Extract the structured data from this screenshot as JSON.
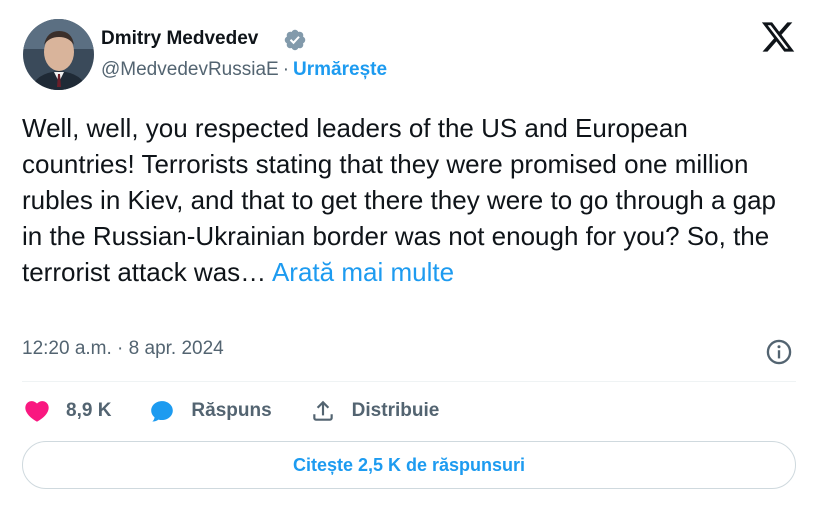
{
  "author": {
    "name": "Dmitry Medvedev",
    "handle": "@MedvedevRussiaE",
    "separator": "·",
    "follow_label": "Urmărește",
    "verified": true
  },
  "brand": {
    "logo_icon": "x-logo-icon"
  },
  "tweet": {
    "text": "Well, well, you respected leaders of the US and European countries! Terrorists stating that they were promised one million rubles in Kiev, and that to get there they were to go through a gap in the Russian-Ukrainian border was not enough for you? So, the terrorist attack was… ",
    "show_more_label": "Arată mai multe"
  },
  "meta": {
    "timestamp": "12:20 a.m. · 8 apr. 2024",
    "info_icon": "info-icon"
  },
  "actions": {
    "likes_count": "8,9 K",
    "reply_label": "Răspuns",
    "share_label": "Distribuie"
  },
  "replies_button": {
    "label": "Citește 2,5 K de răspunsuri"
  },
  "colors": {
    "accent": "#1d9bf0",
    "like": "#f91880",
    "text": "#0f1419",
    "muted": "#536471",
    "border": "#cfd9de"
  }
}
